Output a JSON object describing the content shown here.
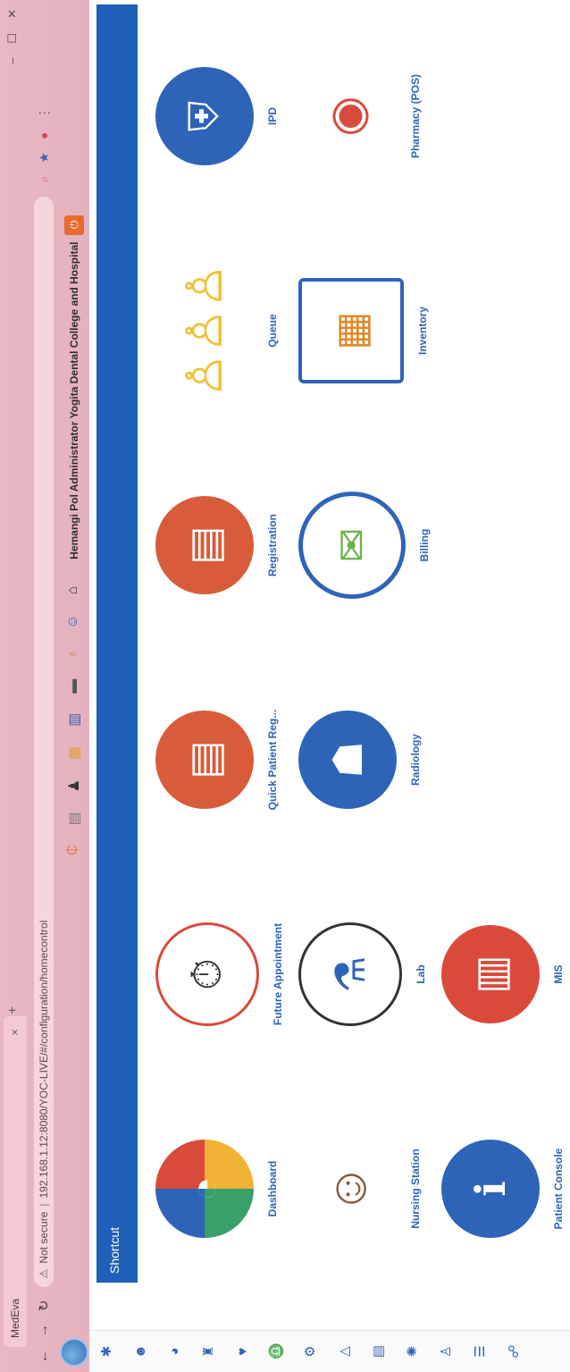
{
  "browser": {
    "tab_title": "MedEva",
    "tab_close": "×",
    "new_tab": "+",
    "url_prefix": "Not secure",
    "url": "192.168.1.12:8080/YOC-LIVE/#/configuration/homecontrol",
    "user_info": "Hemangi Pol Administrator Yogita Dental College and Hospital"
  },
  "shortcut": {
    "title": "Shortcut"
  },
  "tiles": [
    {
      "label": "Dashboard"
    },
    {
      "label": "Future Appointment"
    },
    {
      "label": "Quick Patient Reg..."
    },
    {
      "label": "Registration"
    },
    {
      "label": "Queue"
    },
    {
      "label": "IPD"
    },
    {
      "label": "Nursing Station"
    },
    {
      "label": "Lab"
    },
    {
      "label": "Radiology"
    },
    {
      "label": "Billing"
    },
    {
      "label": "Inventory"
    },
    {
      "label": "Pharmacy (POS)"
    },
    {
      "label": "Patient Console"
    },
    {
      "label": "MIS"
    }
  ],
  "icons": {
    "dashboard": "gauge-icon",
    "future": "calendar-clock-icon",
    "quick": "tablet-form-icon",
    "registration": "tablet-form-icon",
    "queue": "people-queue-icon",
    "ipd": "hospital-bed-icon",
    "nursing": "nurse-icon",
    "lab": "test-tubes-icon",
    "radiology": "xray-icon",
    "billing": "bills-icon",
    "inventory": "shelves-icon",
    "pharmacy": "pills-icon",
    "patient": "patient-info-icon",
    "mis": "report-monitor-icon"
  }
}
